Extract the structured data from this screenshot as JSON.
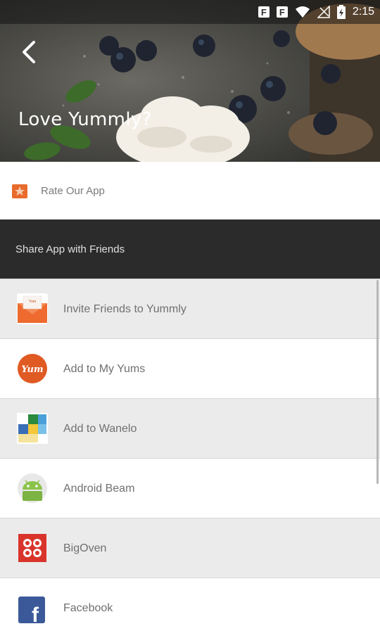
{
  "status_bar": {
    "time": "2:15",
    "notif_icons": [
      "F",
      "F"
    ]
  },
  "hero": {
    "title": "Love Yummly?"
  },
  "rate": {
    "label": "Rate Our App"
  },
  "share": {
    "header": "Share App with Friends"
  },
  "items": [
    {
      "label": "Invite Friends to Yummly",
      "icon": "mail-icon"
    },
    {
      "label": "Add to My Yums",
      "icon": "yum-icon",
      "icon_text": "Yum"
    },
    {
      "label": "Add to Wanelo",
      "icon": "wanelo-icon"
    },
    {
      "label": "Android Beam",
      "icon": "android-icon"
    },
    {
      "label": "BigOven",
      "icon": "bigoven-icon"
    },
    {
      "label": "Facebook",
      "icon": "facebook-icon",
      "icon_text": "f"
    }
  ],
  "colors": {
    "share_bg": "#2b2b2b",
    "row_alt": "#ebebeb",
    "yum_orange": "#e05a23",
    "facebook_blue": "#3b5998"
  }
}
